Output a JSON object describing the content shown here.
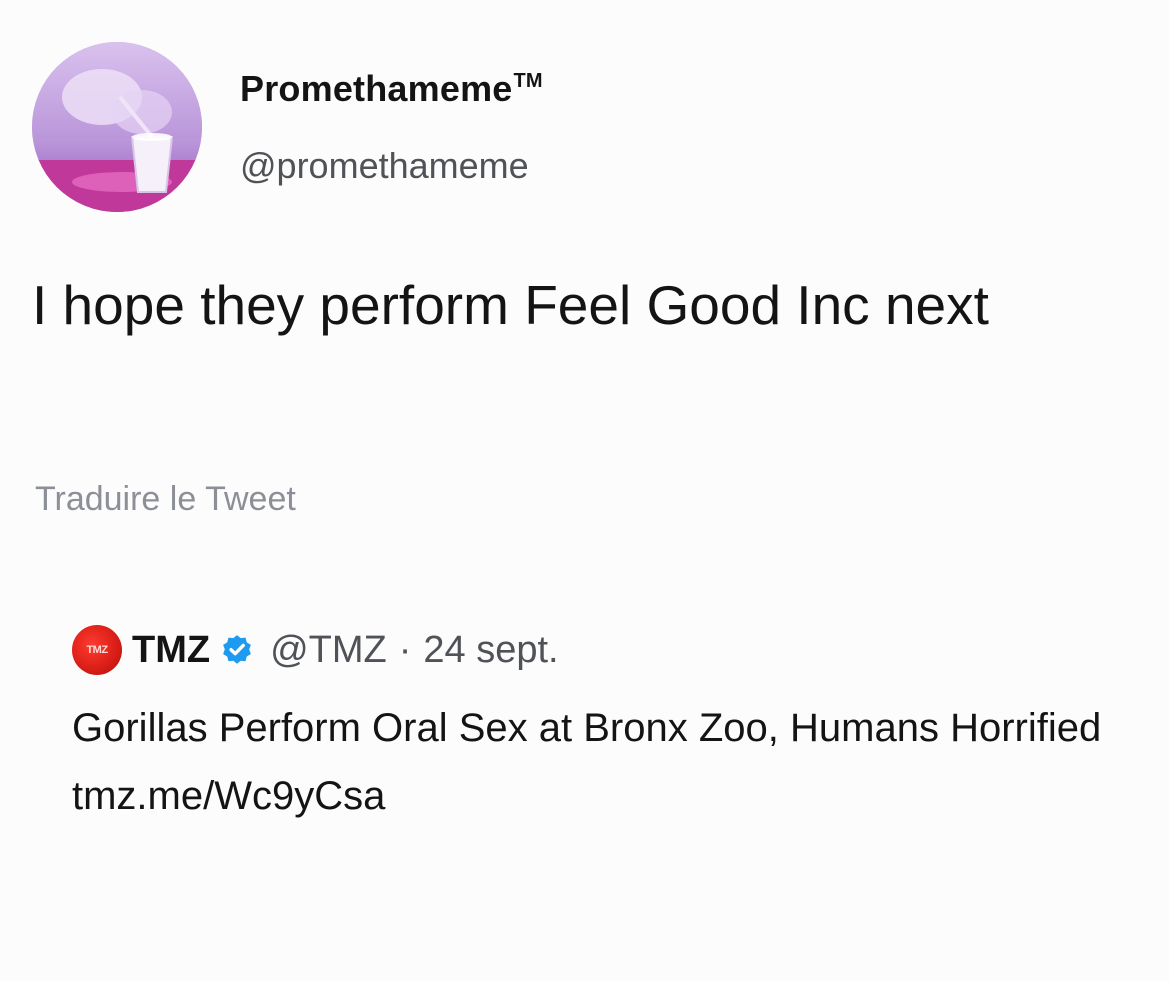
{
  "author": {
    "name": "Promethameme",
    "trademark": "TM",
    "handle": "@promethameme",
    "avatar_icon": "avatar-purple-cup"
  },
  "tweet": {
    "text": "I hope they perform Feel Good Inc next",
    "translate_label": "Traduire le Tweet"
  },
  "quoted_tweet": {
    "logo_text": "TMZ",
    "name": "TMZ",
    "verified_icon": "verified-badge-icon",
    "handle": "@TMZ",
    "separator": "·",
    "date": "24 sept.",
    "text": "Gorillas Perform Oral Sex at Bronx Zoo, Humans Horrified tmz.me/Wc9yCsa"
  },
  "colors": {
    "background": "#fcfcfc",
    "text": "#141414",
    "secondary": "#4f5257",
    "muted": "#8c9096",
    "verified": "#1d9bf0",
    "tmz_red": "#d71d16"
  }
}
